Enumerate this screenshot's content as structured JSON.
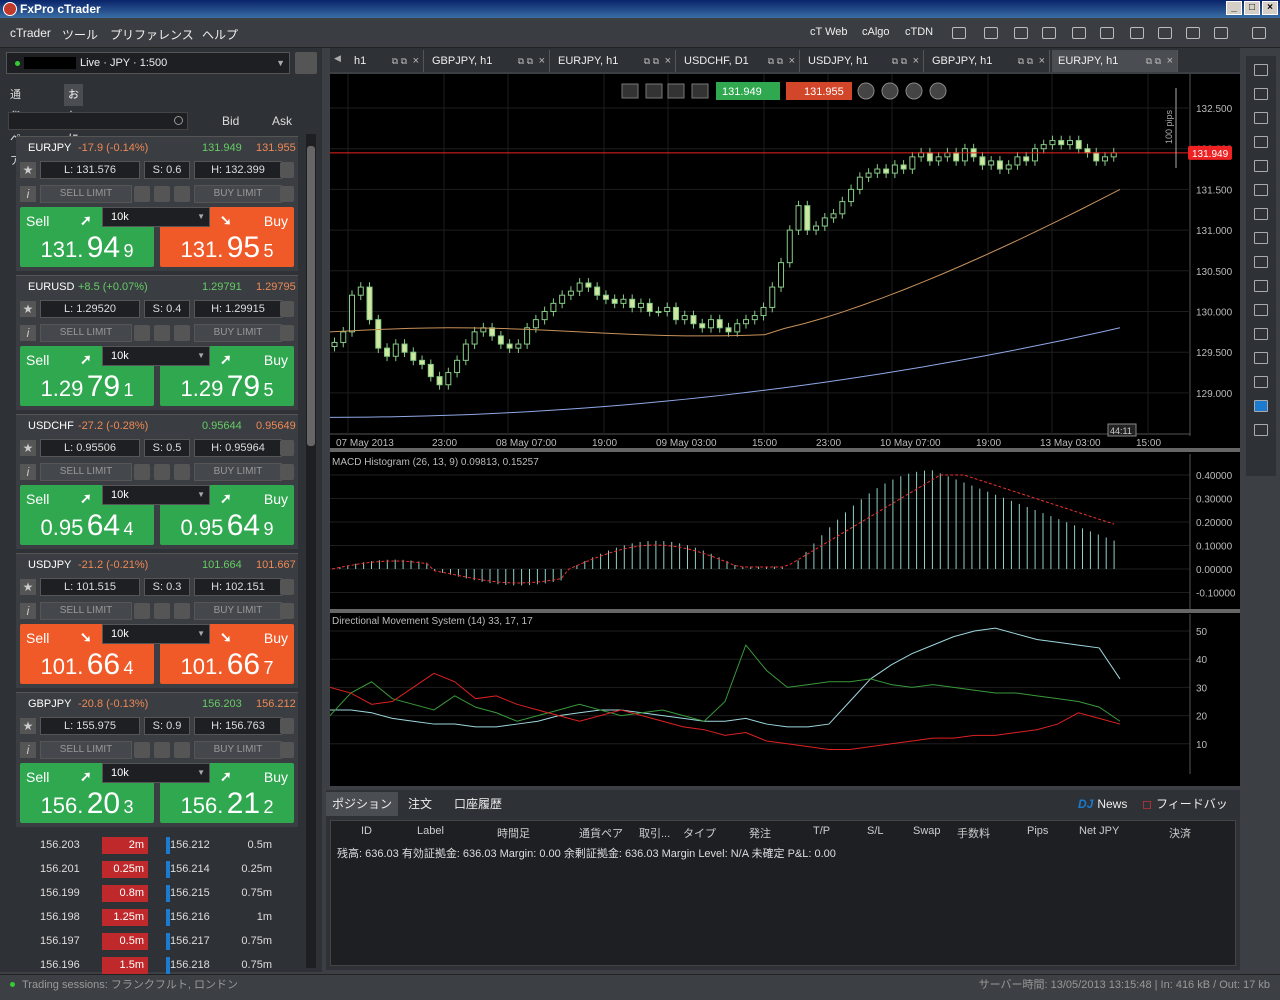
{
  "title": "FxPro cTrader",
  "menu": {
    "items": [
      "cTrader",
      "ツール",
      "プリファレンス",
      "ヘルプ"
    ],
    "right": [
      "cT Web",
      "cAlgo",
      "cTDN"
    ]
  },
  "account": {
    "label": "Live · JPY · 1:500"
  },
  "left_tabs": [
    "通貨ペア",
    "お気に入り"
  ],
  "columns": {
    "bid": "Bid",
    "ask": "Ask"
  },
  "buttons": {
    "sell_limit": "SELL LIMIT",
    "buy_limit": "BUY LIMIT",
    "sell": "Sell",
    "buy": "Buy"
  },
  "symbols": [
    {
      "sym": "EURJPY",
      "chg": "-17.9 (-0.14%)",
      "bid": "131.949",
      "ask": "131.955",
      "low": "L: 131.576",
      "spread": "S: 0.6",
      "high": "H: 132.399",
      "vol": "10k",
      "sell_a": "131.",
      "sell_b": "94",
      "sell_c": "9",
      "buy_a": "131.",
      "buy_b": "95",
      "buy_c": "5",
      "sell_color": "g",
      "buy_color": "o"
    },
    {
      "sym": "EURUSD",
      "chg": "+8.5 (+0.07%)",
      "bid": "1.29791",
      "ask": "1.29795",
      "low": "L: 1.29520",
      "spread": "S: 0.4",
      "high": "H: 1.29915",
      "vol": "10k",
      "sell_a": "1.29",
      "sell_b": "79",
      "sell_c": "1",
      "buy_a": "1.29",
      "buy_b": "79",
      "buy_c": "5",
      "sell_color": "g",
      "buy_color": "g"
    },
    {
      "sym": "USDCHF",
      "chg": "-27.2 (-0.28%)",
      "bid": "0.95644",
      "ask": "0.95649",
      "low": "L: 0.95506",
      "spread": "S: 0.5",
      "high": "H: 0.95964",
      "vol": "10k",
      "sell_a": "0.95",
      "sell_b": "64",
      "sell_c": "4",
      "buy_a": "0.95",
      "buy_b": "64",
      "buy_c": "9",
      "sell_color": "g",
      "buy_color": "g"
    },
    {
      "sym": "USDJPY",
      "chg": "-21.2 (-0.21%)",
      "bid": "101.664",
      "ask": "101.667",
      "low": "L: 101.515",
      "spread": "S: 0.3",
      "high": "H: 102.151",
      "vol": "10k",
      "sell_a": "101.",
      "sell_b": "66",
      "sell_c": "4",
      "buy_a": "101.",
      "buy_b": "66",
      "buy_c": "7",
      "sell_color": "o",
      "buy_color": "o"
    },
    {
      "sym": "GBPJPY",
      "chg": "-20.8 (-0.13%)",
      "bid": "156.203",
      "ask": "156.212",
      "low": "L: 155.975",
      "spread": "S: 0.9",
      "high": "H: 156.763",
      "vol": "10k",
      "sell_a": "156.",
      "sell_b": "20",
      "sell_c": "3",
      "buy_a": "156.",
      "buy_b": "21",
      "buy_c": "2",
      "sell_color": "g",
      "buy_color": "g"
    }
  ],
  "depth": [
    {
      "bp": "156.203",
      "bq": "2m",
      "ap": "156.212",
      "aq": "0.5m"
    },
    {
      "bp": "156.201",
      "bq": "0.25m",
      "ap": "156.214",
      "aq": "0.25m"
    },
    {
      "bp": "156.199",
      "bq": "0.8m",
      "ap": "156.215",
      "aq": "0.75m"
    },
    {
      "bp": "156.198",
      "bq": "1.25m",
      "ap": "156.216",
      "aq": "1m"
    },
    {
      "bp": "156.197",
      "bq": "0.5m",
      "ap": "156.217",
      "aq": "0.75m"
    },
    {
      "bp": "156.196",
      "bq": "1.5m",
      "ap": "156.218",
      "aq": "0.75m"
    }
  ],
  "chart_tabs": [
    "h1",
    "GBPJPY, h1",
    "EURJPY, h1",
    "USDCHF, D1",
    "USDJPY, h1",
    "GBPJPY, h1",
    "EURJPY, h1"
  ],
  "chart_toolbar": {
    "bid": "131.949",
    "ask": "131.955"
  },
  "price_axis": [
    "132.500",
    "132.000",
    "131.500",
    "131.000",
    "130.500",
    "130.000",
    "129.500",
    "129.000"
  ],
  "price_marker": "131.949",
  "pips_label": "100 pips",
  "time_axis": [
    "07 May 2013",
    "23:00",
    "08 May 07:00",
    "19:00",
    "09 May 03:00",
    "15:00",
    "23:00",
    "10 May 07:00",
    "19:00",
    "13 May 03:00",
    "15:00"
  ],
  "countdown": "44:11",
  "macd": {
    "label": "MACD Histogram (26, 13, 9) 0.09813, 0.15257",
    "axis": [
      "0.40000",
      "0.30000",
      "0.20000",
      "0.10000",
      "0.00000",
      "-0.10000"
    ]
  },
  "dms": {
    "label": "Directional Movement System (14) 33, 17, 17",
    "axis": [
      "50",
      "40",
      "30",
      "20",
      "10"
    ]
  },
  "bottom_tabs": [
    "ポジション",
    "注文",
    "口座履歴"
  ],
  "bottom_right": {
    "news": "News",
    "news_badge": "DJ",
    "feedback": "フィードバック"
  },
  "table_headers": [
    "ID",
    "Label",
    "時間足",
    "通貨ペア",
    "取引...",
    "タイプ",
    "発注",
    "T/P",
    "S/L",
    "Swap",
    "手数料",
    "Pips",
    "Net JPY",
    "決済"
  ],
  "summary": "残高: 636.03   有効証拠金: 636.03   Margin: 0.00   余剰証拠金: 636.03   Margin Level: N/A   未確定 P&L: 0.00",
  "status": {
    "sessions": "Trading sessions:  フランクフルト, ロンドン",
    "server": "サーバー時間: 13/05/2013 13:15:48  |  In: 416 kB / Out: 17 kb"
  },
  "colors": {
    "green": "#2fa84f",
    "orange": "#f05a28",
    "bull": "#cfe8a0",
    "ema_slow": "#8fa8e8",
    "ema_fast": "#c8925a"
  }
}
